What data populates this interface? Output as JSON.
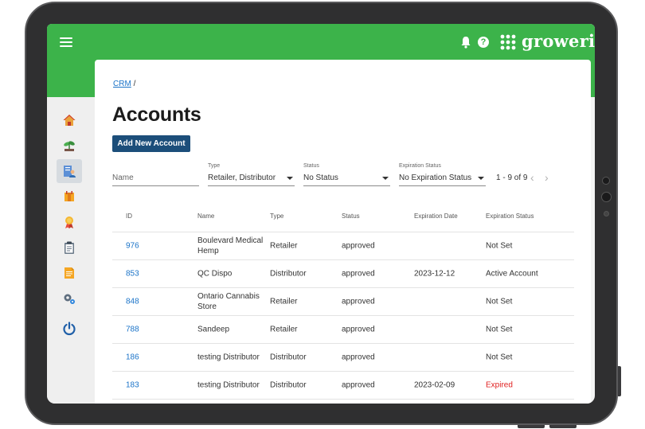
{
  "brand": {
    "name": "groweriq"
  },
  "breadcrumb": {
    "root": "CRM",
    "separator": "/"
  },
  "page": {
    "title": "Accounts"
  },
  "actions": {
    "add_label": "Add New Account"
  },
  "filters": {
    "name": {
      "placeholder": "Name"
    },
    "type": {
      "label": "Type",
      "value": "Retailer, Distributor"
    },
    "status": {
      "label": "Status",
      "value": "No Status"
    },
    "expiration": {
      "label": "Expiration Status",
      "value": "No Expiration Status"
    }
  },
  "pagination": {
    "range": "1 - 9 of 9"
  },
  "table": {
    "columns": [
      "ID",
      "Name",
      "Type",
      "Status",
      "Expiration Date",
      "Expiration Status"
    ],
    "rows": [
      {
        "id": "976",
        "name": "Boulevard Medical Hemp",
        "type": "Retailer",
        "status": "approved",
        "exp_date": "",
        "exp_status": "Not Set"
      },
      {
        "id": "853",
        "name": "QC Dispo",
        "type": "Distributor",
        "status": "approved",
        "exp_date": "2023-12-12",
        "exp_status": "Active Account"
      },
      {
        "id": "848",
        "name": "Ontario Cannabis Store",
        "type": "Retailer",
        "status": "approved",
        "exp_date": "",
        "exp_status": "Not Set"
      },
      {
        "id": "788",
        "name": "Sandeep",
        "type": "Retailer",
        "status": "approved",
        "exp_date": "",
        "exp_status": "Not Set"
      },
      {
        "id": "186",
        "name": "testing Distributor",
        "type": "Distributor",
        "status": "approved",
        "exp_date": "",
        "exp_status": "Not Set"
      },
      {
        "id": "183",
        "name": "testing Distributor",
        "type": "Distributor",
        "status": "approved",
        "exp_date": "2023-02-09",
        "exp_status": "Expired"
      }
    ]
  },
  "colors": {
    "header": "#3cb34a",
    "primary_button": "#1c4e7a",
    "link": "#1a73c8",
    "expired": "#e02020"
  },
  "sidebar": {
    "icons": [
      "home-icon",
      "plant-icon",
      "accounts-icon",
      "inventory-icon",
      "certificate-icon",
      "clipboard-icon",
      "document-icon",
      "settings-icon",
      "power-icon"
    ]
  }
}
